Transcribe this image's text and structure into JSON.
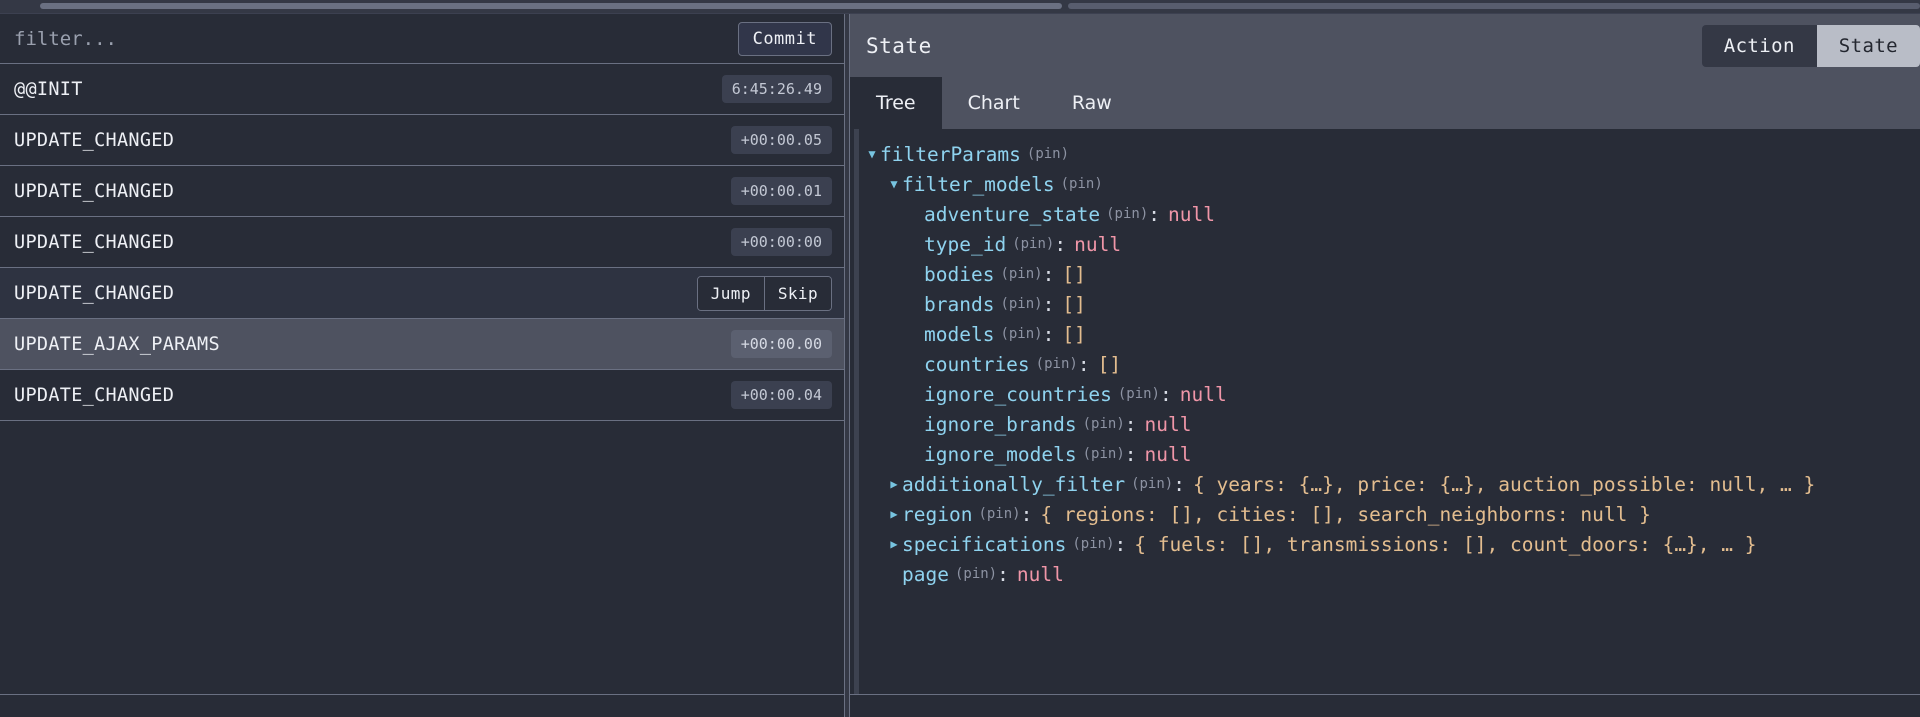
{
  "topbar": {
    "scrollbar_left": "horizontal-scrollbar-left",
    "scrollbar_right": "horizontal-scrollbar-right"
  },
  "left_panel": {
    "filter": {
      "value": "",
      "placeholder": "filter..."
    },
    "commit_label": "Commit",
    "actions": [
      {
        "name": "@@INIT",
        "time": "6:45:26.49",
        "state": "normal"
      },
      {
        "name": "UPDATE_CHANGED",
        "time": "+00:00.05",
        "state": "normal"
      },
      {
        "name": "UPDATE_CHANGED",
        "time": "+00:00.01",
        "state": "normal"
      },
      {
        "name": "UPDATE_CHANGED",
        "time": "+00:00:00",
        "state": "normal"
      },
      {
        "name": "UPDATE_CHANGED",
        "time": "",
        "state": "hovered"
      },
      {
        "name": "UPDATE_AJAX_PARAMS",
        "time": "+00:00.00",
        "state": "selected"
      },
      {
        "name": "UPDATE_CHANGED",
        "time": "+00:00.04",
        "state": "normal"
      }
    ],
    "jump_label": "Jump",
    "skip_label": "Skip"
  },
  "right_panel": {
    "title": "State",
    "header_tabs": [
      {
        "label": "Action",
        "active": false
      },
      {
        "label": "State",
        "active": true
      }
    ],
    "sub_tabs": [
      {
        "label": "Tree",
        "active": true
      },
      {
        "label": "Chart",
        "active": false
      },
      {
        "label": "Raw",
        "active": false
      }
    ],
    "pin_label": "(pin)",
    "tree": [
      {
        "indent": 0,
        "arrow": "down",
        "key": "filterParams",
        "value": "",
        "kind": "none"
      },
      {
        "indent": 1,
        "arrow": "down",
        "key": "filter_models",
        "value": "",
        "kind": "none"
      },
      {
        "indent": 2,
        "arrow": "none",
        "key": "adventure_state",
        "value": "null",
        "kind": "null"
      },
      {
        "indent": 2,
        "arrow": "none",
        "key": "type_id",
        "value": "null",
        "kind": "null"
      },
      {
        "indent": 2,
        "arrow": "none",
        "key": "bodies",
        "value": "[]",
        "kind": "array"
      },
      {
        "indent": 2,
        "arrow": "none",
        "key": "brands",
        "value": "[]",
        "kind": "array"
      },
      {
        "indent": 2,
        "arrow": "none",
        "key": "models",
        "value": "[]",
        "kind": "array"
      },
      {
        "indent": 2,
        "arrow": "none",
        "key": "countries",
        "value": "[]",
        "kind": "array"
      },
      {
        "indent": 2,
        "arrow": "none",
        "key": "ignore_countries",
        "value": "null",
        "kind": "null"
      },
      {
        "indent": 2,
        "arrow": "none",
        "key": "ignore_brands",
        "value": "null",
        "kind": "null"
      },
      {
        "indent": 2,
        "arrow": "none",
        "key": "ignore_models",
        "value": "null",
        "kind": "null"
      },
      {
        "indent": 1,
        "arrow": "right",
        "key": "additionally_filter",
        "value": "{ years: {…}, price: {…}, auction_possible: null, … }",
        "kind": "preview"
      },
      {
        "indent": 1,
        "arrow": "right",
        "key": "region",
        "value": "{ regions: [], cities: [], search_neighborns: null }",
        "kind": "preview"
      },
      {
        "indent": 1,
        "arrow": "right",
        "key": "specifications",
        "value": "{ fuels: [], transmissions: [], count_doors: {…}, … }",
        "kind": "preview"
      },
      {
        "indent": 1,
        "arrow": "none",
        "key": "page",
        "value": "null",
        "kind": "null"
      }
    ]
  },
  "colors": {
    "background": "#282c37",
    "panel_header": "#4e5260",
    "selected_row": "#4e5260",
    "border": "#6a7082",
    "key_blue": "#8fd3ef",
    "null_pink": "#f096a8",
    "value_orange": "#e3bd8f",
    "pin_grey": "#8d93a3",
    "active_tab_light": "#b9bdc7"
  }
}
